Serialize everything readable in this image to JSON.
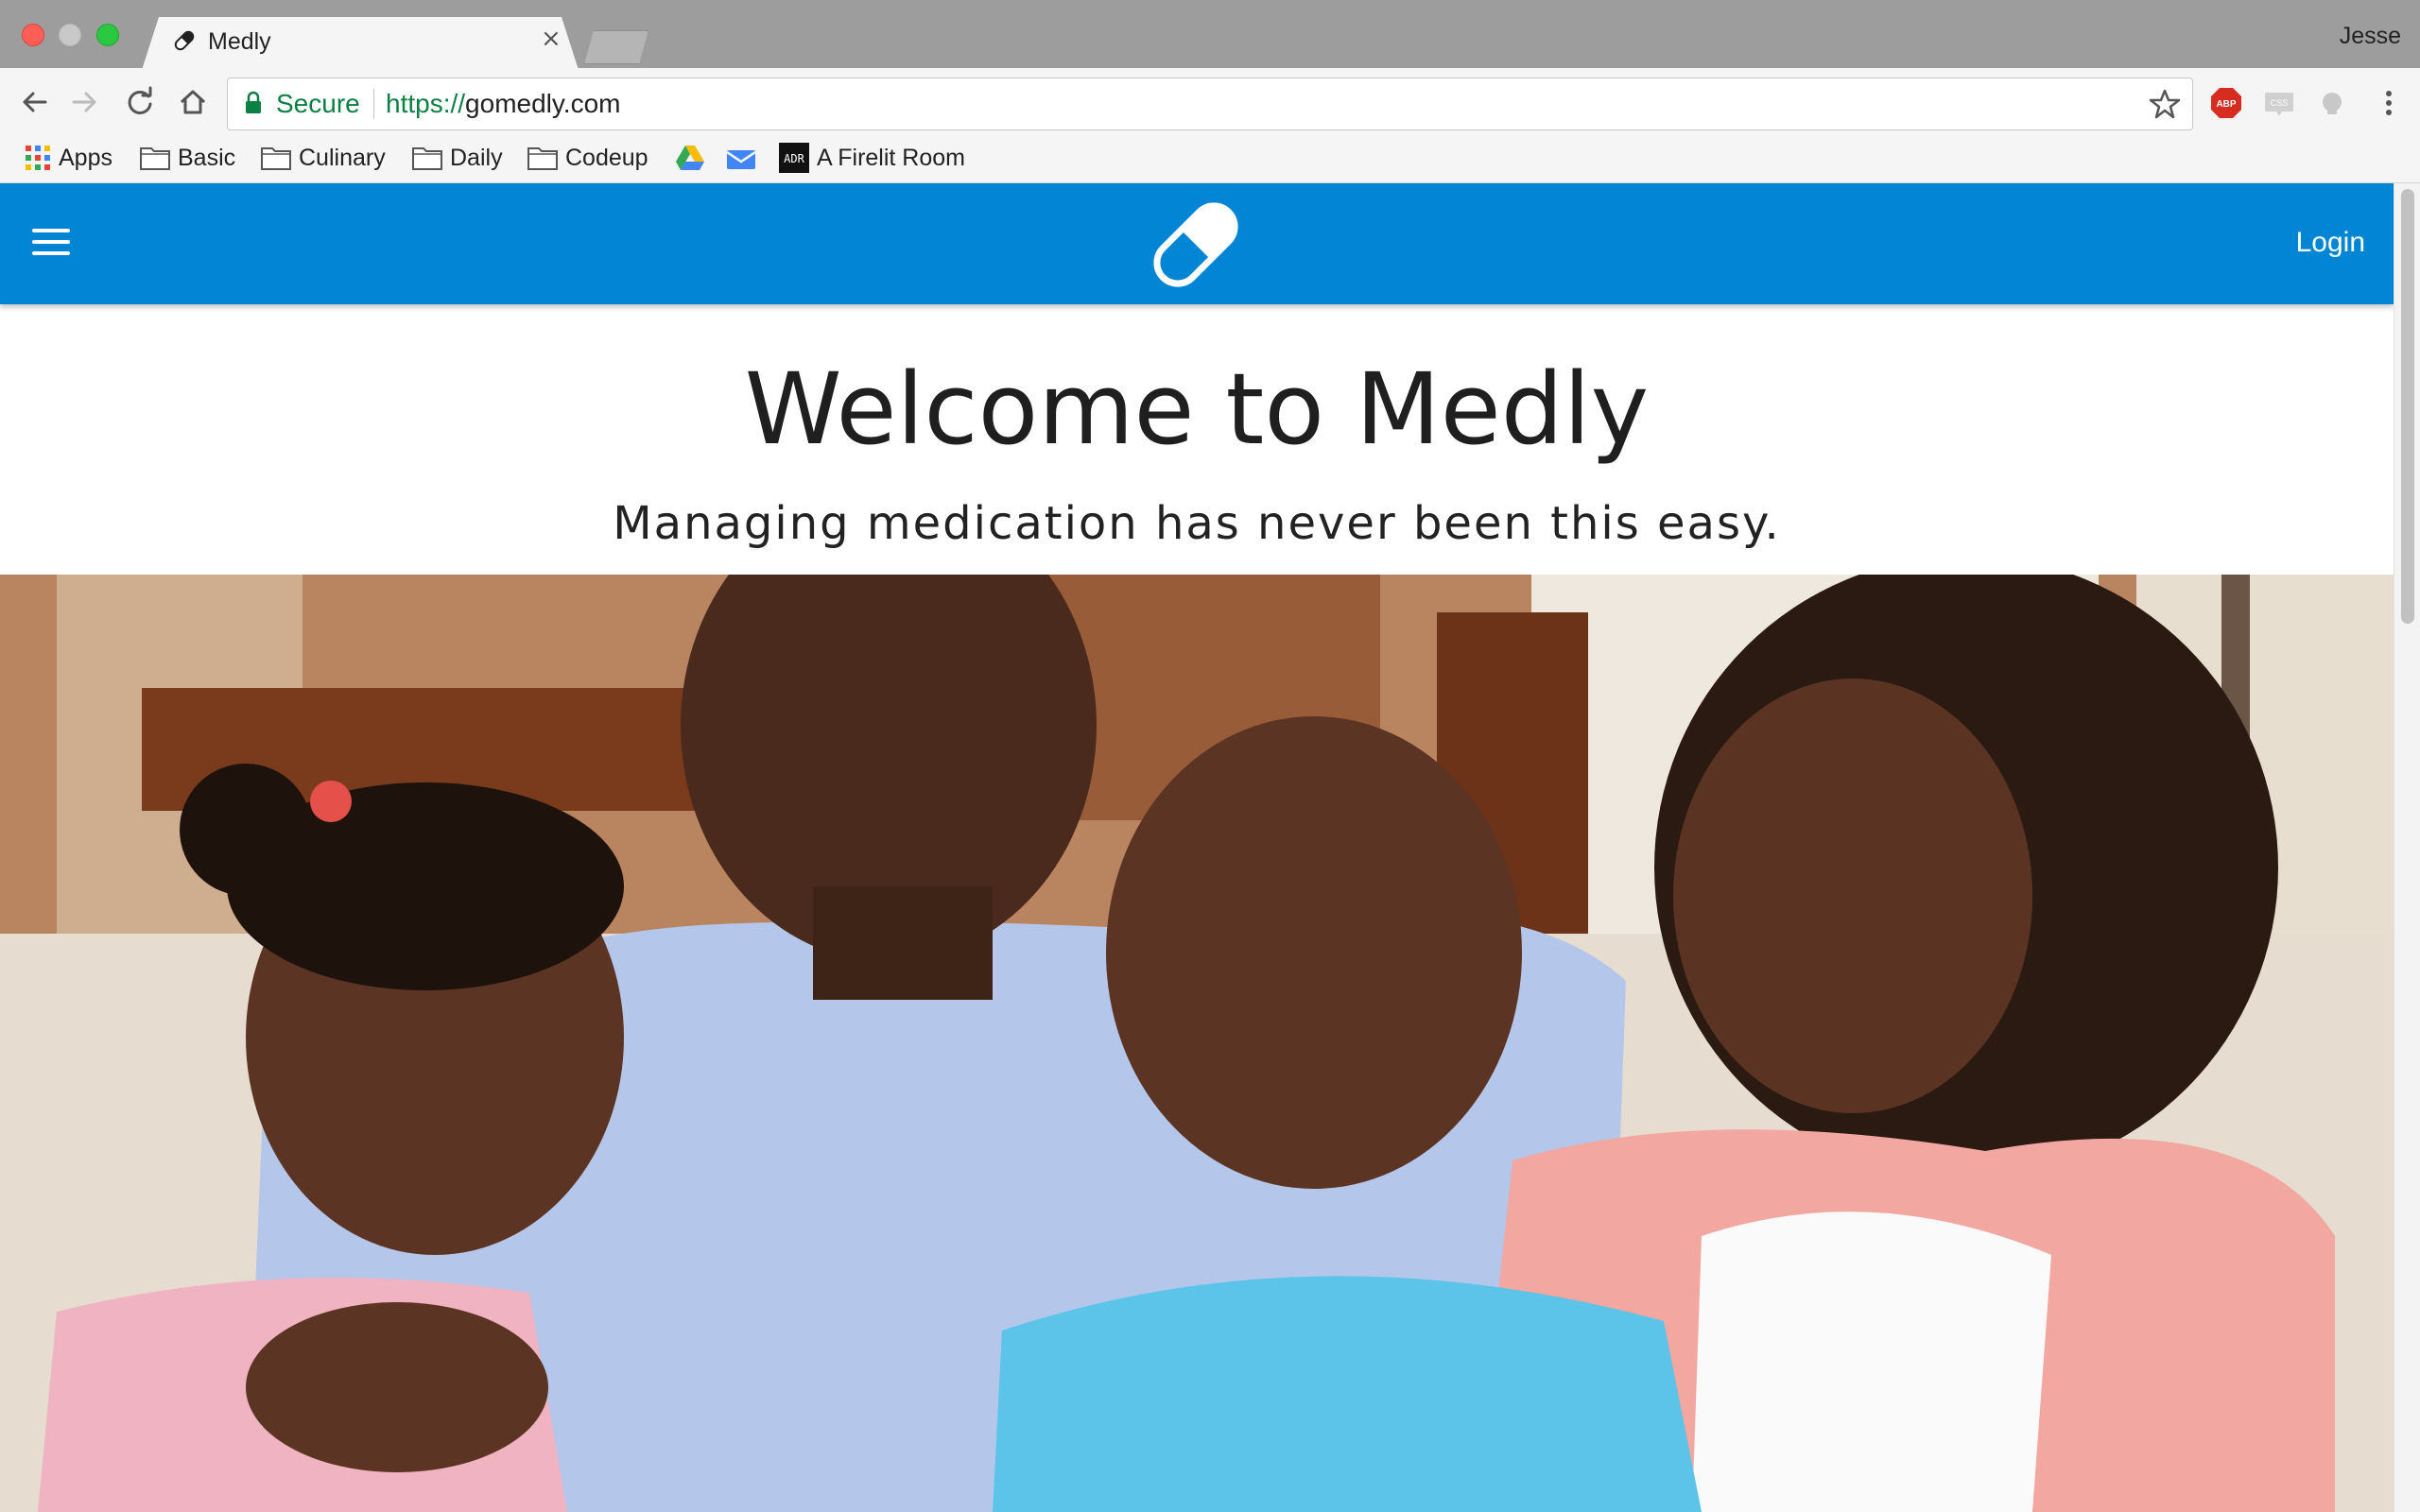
{
  "browser": {
    "tab_title": "Medly",
    "profile_name": "Jesse",
    "secure_label": "Secure",
    "url_scheme": "https://",
    "url_host": "gomedly.com",
    "bookmarks": [
      {
        "label": "Apps",
        "icon": "apps-grid-icon"
      },
      {
        "label": "Basic",
        "icon": "folder-icon"
      },
      {
        "label": "Culinary",
        "icon": "folder-icon"
      },
      {
        "label": "Daily",
        "icon": "folder-icon"
      },
      {
        "label": "Codeup",
        "icon": "folder-icon"
      },
      {
        "label": "",
        "icon": "google-drive-icon"
      },
      {
        "label": "",
        "icon": "inbox-icon"
      },
      {
        "label": "A Firelit Room",
        "icon": "adr-icon"
      }
    ],
    "extensions": [
      "abp-icon",
      "css-icon",
      "extension-icon"
    ],
    "abp_text": "ABP",
    "css_text": "CSS",
    "adr_text": "ADR"
  },
  "app": {
    "login_label": "Login",
    "hero_title": "Welcome to Medly",
    "hero_subtitle": "Managing medication has never been this easy.",
    "brand_color": "#0285d4"
  }
}
